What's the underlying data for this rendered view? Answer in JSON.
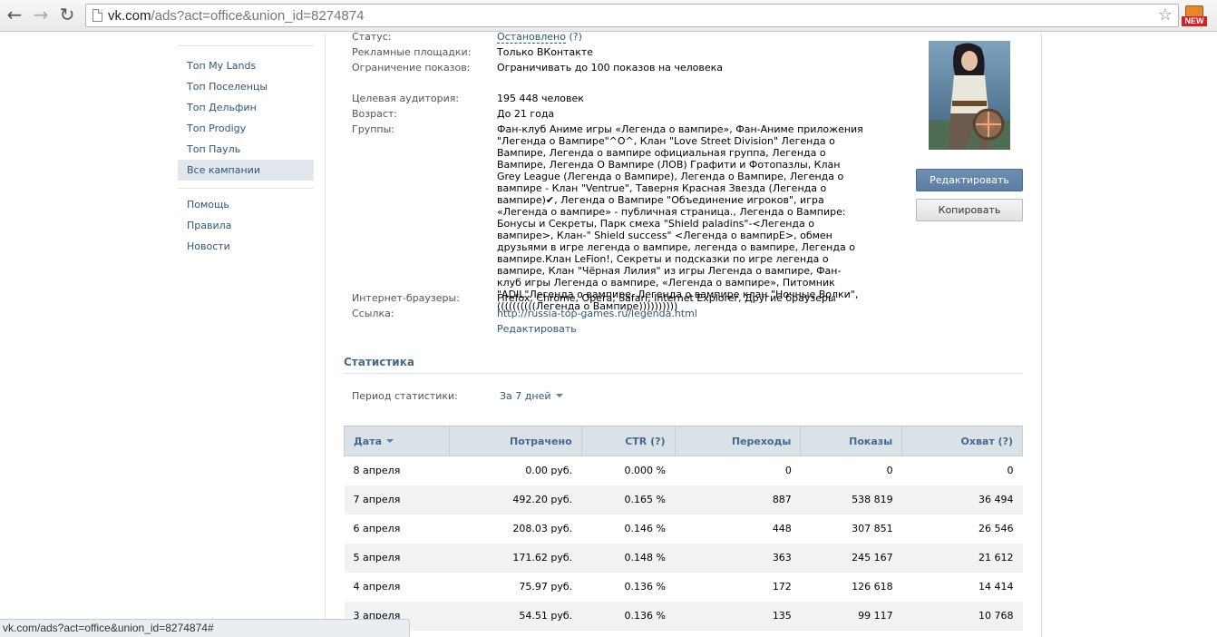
{
  "browser": {
    "url_host": "vk.com",
    "url_path": "/ads?act=office&union_id=8274874",
    "extension_badge": "NEW"
  },
  "sidebar": {
    "items": [
      {
        "label": "Топ My Lands"
      },
      {
        "label": "Топ Поселенцы"
      },
      {
        "label": "Топ Дельфин"
      },
      {
        "label": "Топ Prodigy"
      },
      {
        "label": "Топ Пауль"
      },
      {
        "label": "Все кампании"
      }
    ],
    "footer_items": [
      {
        "label": "Помощь"
      },
      {
        "label": "Правила"
      },
      {
        "label": "Новости"
      }
    ]
  },
  "ad_info": {
    "status_label": "Статус:",
    "status_value": "Остановлено",
    "status_help": "(?)",
    "platforms_label": "Рекламные площадки:",
    "platforms_value": "Только ВКонтакте",
    "limit_label": "Ограничение показов:",
    "limit_value": "Ограничивать до 100 показов на человека",
    "audience_label": "Целевая аудитория:",
    "audience_value": "195 448 человек",
    "age_label": "Возраст:",
    "age_value": "До 21 года",
    "groups_label": "Группы:",
    "groups_value": "Фан-клуб Аниме игры «Легенда о вампире», Фан-Аниме приложения \"Легенда о Вампире\"^O^, Клан \"Love Street Division\" Легенда о Вампире, Легенда о вампире официальная группа, Легенда о Вампире, Легенда О Вампире (ЛОВ) Графити и Фотопазлы, Клан Grey League (Легенда о Вампире), Легенда о Вампире, Легенда о вампире - Клан \"Ventrue\", Таверня Красная Звезда (Легенда о вампире)✔, Легенда о Вампире \"Объединение игроков\", игра «Легенда о вампире» - публичная страница., Легенда о Вампире: Бонусы и Секреты, Парк смеха \"Shield paladins\"-<Легенда о вампире>, Клан-\" Shield success\" <Легенда о вампирE>, обмен друзьями в игре легенда о вампире, легенда о вампире, Легенда о вампире.Клан LeFion!, Секреты и подсказки по игре легенда о вампире, Клан \"Чёрная Лилия\" из игры Легенда о вампире, Фан-клуб игры Легенда о вампире, «Легенда о вампире», Питомник \"ADIL\"Легенда о вампире, Легенда о вампире клан \"Ночные Волки\", ((((((((((Легенда о Вампире))))))))))",
    "browsers_label": "Интернет-браузеры:",
    "browsers_value": "Firefox, Chrome, Opera, Safari, Internet Explorer, Другие браузеры",
    "link_label": "Ссылка:",
    "link_value": "http://russia-top-games.ru/legenda.html",
    "edit_link": "Редактировать"
  },
  "actions": {
    "edit_button": "Редактировать",
    "copy_button": "Копировать"
  },
  "stats": {
    "title": "Статистика",
    "period_label": "Период статистики:",
    "period_value": "За 7 дней",
    "columns": [
      "Дата",
      "Потрачено",
      "CTR (?)",
      "Переходы",
      "Показы",
      "Охват (?)"
    ],
    "rows": [
      [
        "8 апреля",
        "0.00 руб.",
        "0.000 %",
        "0",
        "0",
        "0"
      ],
      [
        "7 апреля",
        "492.20 руб.",
        "0.165 %",
        "887",
        "538 819",
        "36 494"
      ],
      [
        "6 апреля",
        "208.03 руб.",
        "0.146 %",
        "448",
        "307 851",
        "26 546"
      ],
      [
        "5 апреля",
        "171.62 руб.",
        "0.148 %",
        "363",
        "245 167",
        "21 612"
      ],
      [
        "4 апреля",
        "75.97 руб.",
        "0.136 %",
        "172",
        "126 618",
        "14 414"
      ],
      [
        "3 апреля",
        "54.51 руб.",
        "0.136 %",
        "135",
        "99 117",
        "10 768"
      ]
    ]
  },
  "statusbar": {
    "text": "vk.com/ads?act=office&union_id=8274874#"
  }
}
